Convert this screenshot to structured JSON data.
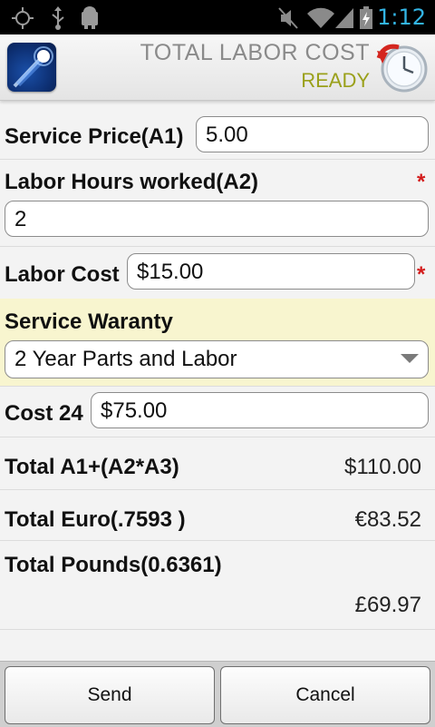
{
  "status_bar": {
    "time": "1:12",
    "icons": [
      "gps-icon",
      "usb-icon",
      "android-debug-icon",
      "mute-icon",
      "wifi-icon",
      "signal-icon",
      "battery-charging-icon"
    ]
  },
  "header": {
    "title": "TOTAL LABOR COST",
    "status": "READY"
  },
  "form": {
    "service_price": {
      "label": "Service Price(A1)",
      "value": "5.00"
    },
    "labor_hours": {
      "label": "Labor Hours worked(A2)",
      "value": "2",
      "required_mark": "*"
    },
    "labor_cost": {
      "label": "Labor Cost",
      "value": "$15.00",
      "required_mark": "*"
    },
    "service_warranty": {
      "label": "Service Waranty",
      "selected": "2 Year Parts and Labor"
    },
    "cost": {
      "label": "Cost 24",
      "value": "$75.00"
    },
    "total_a": {
      "label": "Total A1+(A2*A3)",
      "value": "$110.00"
    },
    "total_euro": {
      "label": "Total Euro(.7593 )",
      "value": "€83.52"
    },
    "total_pounds": {
      "label": "Total Pounds(0.6361)",
      "value": "£69.97"
    }
  },
  "buttons": {
    "send": "Send",
    "cancel": "Cancel"
  },
  "colors": {
    "status_accent": "#33b5e5",
    "ready_status": "#9aa01a",
    "required": "#d31c1c",
    "warranty_highlight": "#f8f5cf"
  }
}
